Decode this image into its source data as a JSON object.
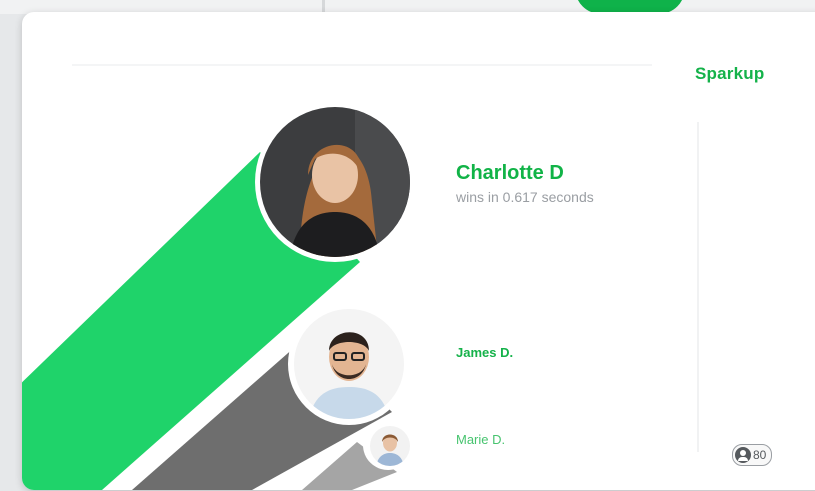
{
  "brand": {
    "name": "Sparkup",
    "color": "#14b24a"
  },
  "leaderboard": {
    "winner": {
      "name": "Charlotte D",
      "result": "wins in 0.617 seconds"
    },
    "second": {
      "name": "James D."
    },
    "third": {
      "name": "Marie D."
    }
  },
  "participants": {
    "icon": "user-icon",
    "count": "80"
  },
  "colors": {
    "winner_bar": "#1fd36a",
    "second_bar": "#6e6e6e",
    "third_bar": "#a5a5a5"
  }
}
